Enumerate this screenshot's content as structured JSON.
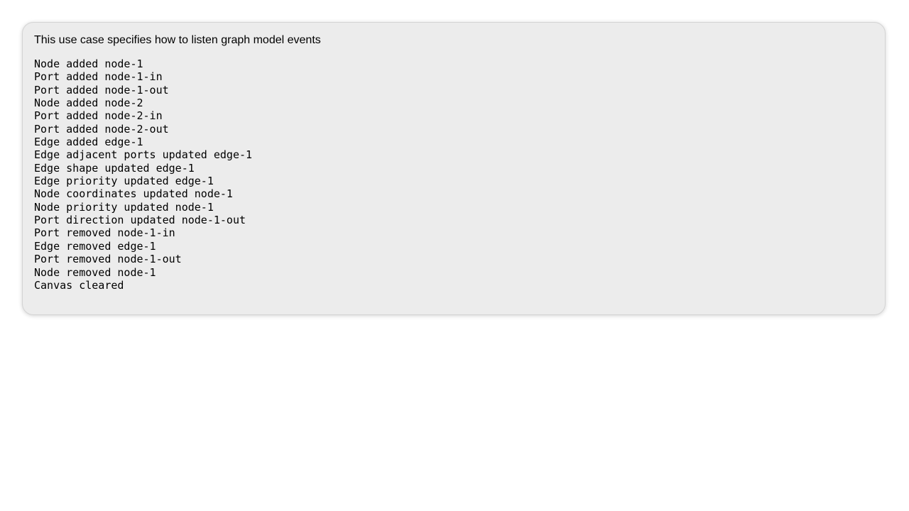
{
  "panel": {
    "description": "This use case specifies how to listen graph model events"
  },
  "event_log": {
    "lines": [
      "Node added node-1",
      "Port added node-1-in",
      "Port added node-1-out",
      "Node added node-2",
      "Port added node-2-in",
      "Port added node-2-out",
      "Edge added edge-1",
      "Edge adjacent ports updated edge-1",
      "Edge shape updated edge-1",
      "Edge priority updated edge-1",
      "Node coordinates updated node-1",
      "Node priority updated node-1",
      "Port direction updated node-1-out",
      "Port removed node-1-in",
      "Edge removed edge-1",
      "Port removed node-1-out",
      "Node removed node-1",
      "Canvas cleared"
    ]
  }
}
